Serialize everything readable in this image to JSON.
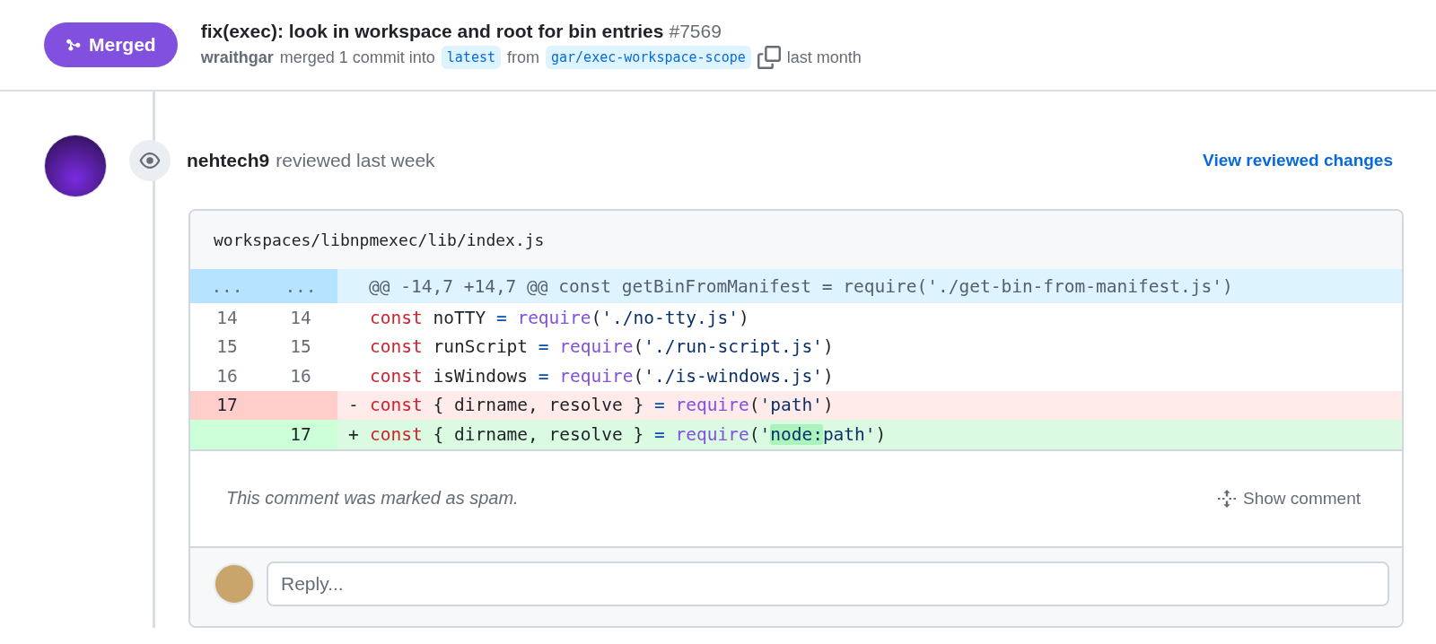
{
  "pr": {
    "state": "Merged",
    "title": "fix(exec): look in workspace and root for bin entries",
    "number": "#7569",
    "author": "wraithgar",
    "action": "merged 1 commit into",
    "base_branch": "latest",
    "from_label": "from",
    "head_branch": "gar/exec-workspace-scope",
    "time": "last month"
  },
  "review": {
    "reviewer": "nehtech9",
    "action": "reviewed last week",
    "link": "View reviewed changes",
    "file": "workspaces/libnpmexec/lib/index.js",
    "lines": [
      {
        "kind": "hunk",
        "old": "...",
        "new": "...",
        "tokens": [
          {
            "kind": "meta",
            "text": "@@ -14,7 +14,7 @@ const getBinFromManifest = require('./get-bin-from-manifest.js')"
          }
        ]
      },
      {
        "kind": "context",
        "old": "14",
        "new": "14",
        "tokens": [
          {
            "kind": "keyword",
            "text": "const"
          },
          {
            "kind": "plain",
            "text": " noTTY"
          },
          {
            "kind": "op",
            "text": " = "
          },
          {
            "kind": "func",
            "text": "require"
          },
          {
            "kind": "plain",
            "text": "("
          },
          {
            "kind": "string",
            "text": "'./no-tty.js'"
          },
          {
            "kind": "plain",
            "text": ")"
          }
        ]
      },
      {
        "kind": "context",
        "old": "15",
        "new": "15",
        "tokens": [
          {
            "kind": "keyword",
            "text": "const"
          },
          {
            "kind": "plain",
            "text": " runScript"
          },
          {
            "kind": "op",
            "text": " = "
          },
          {
            "kind": "func",
            "text": "require"
          },
          {
            "kind": "plain",
            "text": "("
          },
          {
            "kind": "string",
            "text": "'./run-script.js'"
          },
          {
            "kind": "plain",
            "text": ")"
          }
        ]
      },
      {
        "kind": "context",
        "old": "16",
        "new": "16",
        "tokens": [
          {
            "kind": "keyword",
            "text": "const"
          },
          {
            "kind": "plain",
            "text": " isWindows"
          },
          {
            "kind": "op",
            "text": " = "
          },
          {
            "kind": "func",
            "text": "require"
          },
          {
            "kind": "plain",
            "text": "("
          },
          {
            "kind": "string",
            "text": "'./is-windows.js'"
          },
          {
            "kind": "plain",
            "text": ")"
          }
        ]
      },
      {
        "kind": "deletion",
        "old": "17",
        "marker": "-",
        "tokens": [
          {
            "kind": "keyword",
            "text": "const"
          },
          {
            "kind": "plain",
            "text": " { dirname, resolve }"
          },
          {
            "kind": "op",
            "text": " = "
          },
          {
            "kind": "func",
            "text": "require"
          },
          {
            "kind": "plain",
            "text": "("
          },
          {
            "kind": "string",
            "text": "'path'"
          },
          {
            "kind": "plain",
            "text": ")"
          }
        ]
      },
      {
        "kind": "addition",
        "new": "17",
        "marker": "+",
        "tokens": [
          {
            "kind": "keyword",
            "text": "const"
          },
          {
            "kind": "plain",
            "text": " { dirname, resolve }"
          },
          {
            "kind": "op",
            "text": " = "
          },
          {
            "kind": "func",
            "text": "require"
          },
          {
            "kind": "plain",
            "text": "("
          },
          {
            "kind": "string",
            "text": "'"
          },
          {
            "kind": "changed",
            "text": "node:"
          },
          {
            "kind": "string",
            "text": "path'"
          },
          {
            "kind": "plain",
            "text": ")"
          }
        ]
      }
    ],
    "comment": {
      "text": "This comment was marked as spam.",
      "button": "Show comment"
    },
    "reply": {
      "placeholder": "Reply..."
    }
  }
}
